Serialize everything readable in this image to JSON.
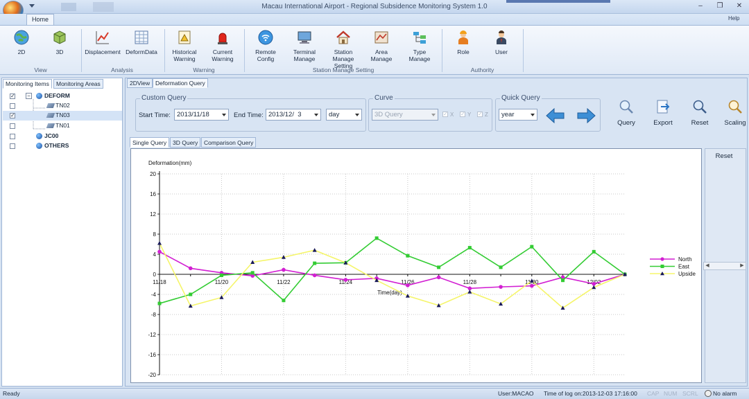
{
  "window": {
    "title": "Macau International Airport - Regional Subsidence Monitoring System 1.0",
    "controls": [
      "–",
      "❐",
      "✕"
    ]
  },
  "ribbon": {
    "home_tab": "Home",
    "help": "Help",
    "buttons": {
      "b2d": "2D",
      "b3d": "3D",
      "displacement": "Displacement",
      "deformdata": "DeformData",
      "historical_warning": "Historical\nWarning",
      "current_warning": "Current\nWarning",
      "remote_config": "Remote\nConfig",
      "terminal_manage": "Terminal\nManage",
      "station_manage": "Station\nManage\nSetting",
      "area_manage": "Area\nManage",
      "type_manage": "Type\nManage",
      "role": "Role",
      "user": "User"
    },
    "groups": {
      "view": "View",
      "analysis": "Analysis",
      "warning": "Warning",
      "authority": "Authority"
    }
  },
  "left": {
    "tabs": [
      "Monitoring Items",
      "Monitoring Areas"
    ],
    "tree": {
      "deform": "DEFORM",
      "tn02": "TN02",
      "tn03": "TN03",
      "tn01": "TN01",
      "jc00": "JC00",
      "others": "OTHERS",
      "toggle": "−"
    }
  },
  "main": {
    "tabs": [
      "2DView",
      "Deformation Query"
    ],
    "custom_query": {
      "legend": "Custom Query",
      "start_label": "Start Time:",
      "start_value": "2013/11/18",
      "end_label": "End Time:",
      "end_value": "2013/12/  3",
      "unit_value": "day"
    },
    "curve": {
      "legend": "Curve",
      "mode_value": "3D Query",
      "x": "X",
      "y": "Y",
      "z": "Z"
    },
    "quick_query": {
      "legend": "Quick Query",
      "period_value": "year"
    },
    "toolbar": {
      "query": "Query",
      "export": "Export",
      "reset": "Reset",
      "scaling": "Scaling"
    },
    "subtabs": [
      "Single Query",
      "3D Query",
      "Comparison Query"
    ],
    "side_reset": "Reset"
  },
  "chart_data": {
    "type": "line",
    "ylabel": "Deformation(mm)",
    "xlabel": "Time(day)",
    "ylim": [
      -20,
      20
    ],
    "yticks": [
      20,
      16,
      12,
      8,
      4,
      0,
      -4,
      -8,
      -12,
      -16,
      -20
    ],
    "x_tick_labels": [
      "11/18",
      "11/20",
      "11/22",
      "11/24",
      "11/26",
      "11/28",
      "11/30",
      "12/02"
    ],
    "categories": [
      "11/18",
      "11/19",
      "11/20",
      "11/21",
      "11/22",
      "11/23",
      "11/24",
      "11/25",
      "11/26",
      "11/27",
      "11/28",
      "11/29",
      "11/30",
      "12/01",
      "12/02",
      "12/03"
    ],
    "grid": true,
    "legend_position": "right",
    "series": [
      {
        "name": "North",
        "color": "#d21fd2",
        "marker": "circle",
        "values": [
          4.5,
          1.2,
          0.3,
          -0.3,
          0.9,
          -0.2,
          -1.1,
          -0.8,
          -2.2,
          -0.6,
          -2.8,
          -2.5,
          -2.3,
          -0.6,
          -1.9,
          0
        ]
      },
      {
        "name": "East",
        "color": "#33cc33",
        "marker": "square",
        "values": [
          -5.8,
          -4.0,
          -0.2,
          0.3,
          -5.2,
          2.2,
          2.3,
          7.2,
          3.7,
          1.4,
          5.3,
          1.4,
          5.5,
          -1.2,
          4.5,
          0
        ]
      },
      {
        "name": "Upside",
        "color": "#f5f56a",
        "marker": "triangle",
        "values": [
          6.2,
          -6.3,
          -4.6,
          2.4,
          3.4,
          4.8,
          2.3,
          -1.2,
          -4.3,
          -6.2,
          -3.5,
          -5.9,
          -1.3,
          -6.7,
          -2.6,
          0
        ]
      }
    ]
  },
  "status": {
    "ready": "Ready",
    "user": "User:MACAO",
    "logon": "Time of log on:2013-12-03 17:16:00",
    "cap": "CAP",
    "num": "NUM",
    "scrl": "SCRL",
    "alarm": "No alarm"
  }
}
